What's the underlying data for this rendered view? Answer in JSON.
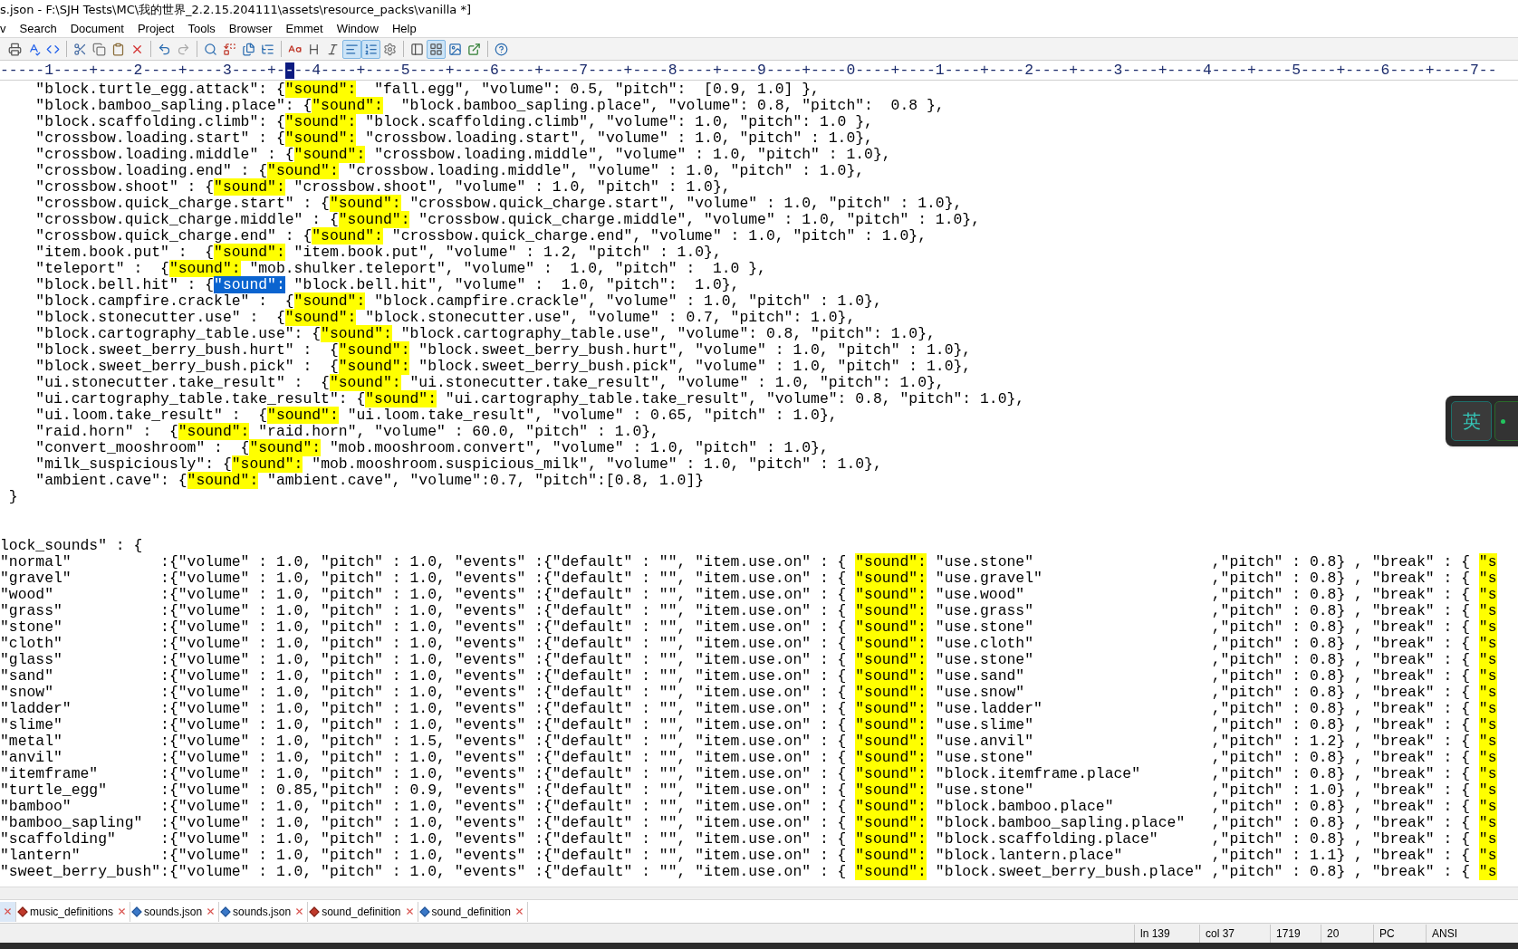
{
  "window": {
    "title": "s.json - F:\\SJH Tests\\MC\\我的世界_2.2.15.204111\\assets\\resource_packs\\vanilla *]"
  },
  "menu": [
    {
      "label": "v"
    },
    {
      "label": "Search"
    },
    {
      "label": "Document"
    },
    {
      "label": "Project"
    },
    {
      "label": "Tools"
    },
    {
      "label": "Browser"
    },
    {
      "label": "Emmet"
    },
    {
      "label": "Window"
    },
    {
      "label": "Help"
    }
  ],
  "toolbar": {
    "groups": [
      [
        {
          "on": false
        },
        {
          "on": false
        },
        {
          "on": false
        }
      ],
      [
        {
          "on": false
        },
        {
          "on": false
        },
        {
          "on": false
        },
        {
          "on": false
        }
      ],
      [
        {
          "on": false
        },
        {
          "on": false
        }
      ],
      [
        {
          "on": false
        },
        {
          "on": false
        },
        {
          "on": false
        },
        {
          "on": false
        }
      ],
      [
        {
          "on": false
        },
        {
          "on": false
        },
        {
          "on": false
        },
        {
          "on": true
        },
        {
          "on": true
        },
        {
          "on": false
        }
      ],
      [
        {
          "on": false
        },
        {
          "on": true
        },
        {
          "on": false
        },
        {
          "on": false
        }
      ],
      [
        {
          "on": false
        }
      ]
    ]
  },
  "ruler": {
    "left": "-----1----+----2----+----3----+-",
    "cursor": "-",
    "right": "--4----+----5----+----6----+----7----+----8----+----9----+----0----+----1----+----2----+----3----+----4----+----5----+----6----+----7--"
  },
  "editor": {
    "lines": [
      {
        "kind": "code",
        "segments": [
          {
            "kind": "text",
            "text": "    \"block.turtle_egg.attack\": {"
          },
          {
            "kind": "match",
            "text": "\"sound\":"
          },
          {
            "kind": "text",
            "text": "  \"fall.egg\", \"volume\": 0.5, \"pitch\":  [0.9, 1.0] },"
          }
        ]
      },
      {
        "kind": "code",
        "segments": [
          {
            "kind": "text",
            "text": "    \"block.bamboo_sapling.place\": {"
          },
          {
            "kind": "match",
            "text": "\"sound\":"
          },
          {
            "kind": "text",
            "text": "  \"block.bamboo_sapling.place\", \"volume\": 0.8, \"pitch\":  0.8 },"
          }
        ]
      },
      {
        "kind": "code",
        "segments": [
          {
            "kind": "text",
            "text": "    \"block.scaffolding.climb\": {"
          },
          {
            "kind": "match",
            "text": "\"sound\":"
          },
          {
            "kind": "text",
            "text": " \"block.scaffolding.climb\", \"volume\": 1.0, \"pitch\": 1.0 },"
          }
        ]
      },
      {
        "kind": "code",
        "segments": [
          {
            "kind": "text",
            "text": "    \"crossbow.loading.start\" : {"
          },
          {
            "kind": "match",
            "text": "\"sound\":"
          },
          {
            "kind": "text",
            "text": " \"crossbow.loading.start\", \"volume\" : 1.0, \"pitch\" : 1.0},"
          }
        ]
      },
      {
        "kind": "code",
        "segments": [
          {
            "kind": "text",
            "text": "    \"crossbow.loading.middle\" : {"
          },
          {
            "kind": "match",
            "text": "\"sound\":"
          },
          {
            "kind": "text",
            "text": " \"crossbow.loading.middle\", \"volume\" : 1.0, \"pitch\" : 1.0},"
          }
        ]
      },
      {
        "kind": "code",
        "segments": [
          {
            "kind": "text",
            "text": "    \"crossbow.loading.end\" : {"
          },
          {
            "kind": "match",
            "text": "\"sound\":"
          },
          {
            "kind": "text",
            "text": " \"crossbow.loading.middle\", \"volume\" : 1.0, \"pitch\" : 1.0},"
          }
        ]
      },
      {
        "kind": "code",
        "segments": [
          {
            "kind": "text",
            "text": "    \"crossbow.shoot\" : {"
          },
          {
            "kind": "match",
            "text": "\"sound\":"
          },
          {
            "kind": "text",
            "text": " \"crossbow.shoot\", \"volume\" : 1.0, \"pitch\" : 1.0},"
          }
        ]
      },
      {
        "kind": "code",
        "segments": [
          {
            "kind": "text",
            "text": "    \"crossbow.quick_charge.start\" : {"
          },
          {
            "kind": "match",
            "text": "\"sound\":"
          },
          {
            "kind": "text",
            "text": " \"crossbow.quick_charge.start\", \"volume\" : 1.0, \"pitch\" : 1.0},"
          }
        ]
      },
      {
        "kind": "code",
        "segments": [
          {
            "kind": "text",
            "text": "    \"crossbow.quick_charge.middle\" : {"
          },
          {
            "kind": "match",
            "text": "\"sound\":"
          },
          {
            "kind": "text",
            "text": " \"crossbow.quick_charge.middle\", \"volume\" : 1.0, \"pitch\" : 1.0},"
          }
        ]
      },
      {
        "kind": "code",
        "segments": [
          {
            "kind": "text",
            "text": "    \"crossbow.quick_charge.end\" : {"
          },
          {
            "kind": "match",
            "text": "\"sound\":"
          },
          {
            "kind": "text",
            "text": " \"crossbow.quick_charge.end\", \"volume\" : 1.0, \"pitch\" : 1.0},"
          }
        ]
      },
      {
        "kind": "code",
        "segments": [
          {
            "kind": "text",
            "text": "    \"item.book.put\" :  {"
          },
          {
            "kind": "match",
            "text": "\"sound\":"
          },
          {
            "kind": "text",
            "text": " \"item.book.put\", \"volume\" : 1.2, \"pitch\" : 1.0},"
          }
        ]
      },
      {
        "kind": "code",
        "segments": [
          {
            "kind": "text",
            "text": "    \"teleport\" :  {"
          },
          {
            "kind": "match",
            "text": "\"sound\":"
          },
          {
            "kind": "text",
            "text": " \"mob.shulker.teleport\", \"volume\" :  1.0, \"pitch\" :  1.0 },"
          }
        ]
      },
      {
        "kind": "code",
        "segments": [
          {
            "kind": "text",
            "text": "    \"block.bell.hit\" : {"
          },
          {
            "kind": "selected",
            "text": "\"sound\":"
          },
          {
            "kind": "text",
            "text": " \"block.bell.hit\", \"volume\" :  1.0, \"pitch\":  1.0},"
          }
        ]
      },
      {
        "kind": "code",
        "segments": [
          {
            "kind": "text",
            "text": "    \"block.campfire.crackle\" :  {"
          },
          {
            "kind": "match",
            "text": "\"sound\":"
          },
          {
            "kind": "text",
            "text": " \"block.campfire.crackle\", \"volume\" : 1.0, \"pitch\" : 1.0},"
          }
        ]
      },
      {
        "kind": "code",
        "segments": [
          {
            "kind": "text",
            "text": "    \"block.stonecutter.use\" :  {"
          },
          {
            "kind": "match",
            "text": "\"sound\":"
          },
          {
            "kind": "text",
            "text": " \"block.stonecutter.use\", \"volume\" : 0.7, \"pitch\": 1.0},"
          }
        ]
      },
      {
        "kind": "code",
        "segments": [
          {
            "kind": "text",
            "text": "    \"block.cartography_table.use\": {"
          },
          {
            "kind": "match",
            "text": "\"sound\":"
          },
          {
            "kind": "text",
            "text": " \"block.cartography_table.use\", \"volume\": 0.8, \"pitch\": 1.0},"
          }
        ]
      },
      {
        "kind": "code",
        "segments": [
          {
            "kind": "text",
            "text": "    \"block.sweet_berry_bush.hurt\" :  {"
          },
          {
            "kind": "match",
            "text": "\"sound\":"
          },
          {
            "kind": "text",
            "text": " \"block.sweet_berry_bush.hurt\", \"volume\" : 1.0, \"pitch\" : 1.0},"
          }
        ]
      },
      {
        "kind": "code",
        "segments": [
          {
            "kind": "text",
            "text": "    \"block.sweet_berry_bush.pick\" :  {"
          },
          {
            "kind": "match",
            "text": "\"sound\":"
          },
          {
            "kind": "text",
            "text": " \"block.sweet_berry_bush.pick\", \"volume\" : 1.0, \"pitch\" : 1.0},"
          }
        ]
      },
      {
        "kind": "code",
        "segments": [
          {
            "kind": "text",
            "text": "    \"ui.stonecutter.take_result\" :  {"
          },
          {
            "kind": "match",
            "text": "\"sound\":"
          },
          {
            "kind": "text",
            "text": " \"ui.stonecutter.take_result\", \"volume\" : 1.0, \"pitch\": 1.0},"
          }
        ]
      },
      {
        "kind": "code",
        "segments": [
          {
            "kind": "text",
            "text": "    \"ui.cartography_table.take_result\": {"
          },
          {
            "kind": "match",
            "text": "\"sound\":"
          },
          {
            "kind": "text",
            "text": " \"ui.cartography_table.take_result\", \"volume\": 0.8, \"pitch\": 1.0},"
          }
        ]
      },
      {
        "kind": "code",
        "segments": [
          {
            "kind": "text",
            "text": "    \"ui.loom.take_result\" :  {"
          },
          {
            "kind": "match",
            "text": "\"sound\":"
          },
          {
            "kind": "text",
            "text": " \"ui.loom.take_result\", \"volume\" : 0.65, \"pitch\" : 1.0},"
          }
        ]
      },
      {
        "kind": "code",
        "segments": [
          {
            "kind": "text",
            "text": "    \"raid.horn\" :  {"
          },
          {
            "kind": "match",
            "text": "\"sound\":"
          },
          {
            "kind": "text",
            "text": " \"raid.horn\", \"volume\" : 60.0, \"pitch\" : 1.0},"
          }
        ]
      },
      {
        "kind": "code",
        "segments": [
          {
            "kind": "text",
            "text": "    \"convert_mooshroom\" :  {"
          },
          {
            "kind": "match",
            "text": "\"sound\":"
          },
          {
            "kind": "text",
            "text": " \"mob.mooshroom.convert\", \"volume\" : 1.0, \"pitch\" : 1.0},"
          }
        ]
      },
      {
        "kind": "code",
        "segments": [
          {
            "kind": "text",
            "text": "    \"milk_suspiciously\": {"
          },
          {
            "kind": "match",
            "text": "\"sound\":"
          },
          {
            "kind": "text",
            "text": " \"mob.mooshroom.suspicious_milk\", \"volume\" : 1.0, \"pitch\" : 1.0},"
          }
        ]
      },
      {
        "kind": "code",
        "segments": [
          {
            "kind": "text",
            "text": "    \"ambient.cave\": {"
          },
          {
            "kind": "match",
            "text": "\"sound\":"
          },
          {
            "kind": "text",
            "text": " \"ambient.cave\", \"volume\":0.7, \"pitch\":[0.8, 1.0]}"
          }
        ]
      },
      {
        "kind": "code",
        "segments": [
          {
            "kind": "text",
            "text": " }"
          }
        ]
      },
      {
        "kind": "blank"
      },
      {
        "kind": "blank"
      },
      {
        "kind": "code",
        "segments": [
          {
            "kind": "text",
            "text": "lock_sounds\" : {"
          }
        ]
      },
      {
        "kind": "code",
        "segments": [
          {
            "kind": "text",
            "text": "\"normal\"          :{\"volume\" : 1.0, \"pitch\" : 1.0, \"events\" :{\"default\" : \"\", \"item.use.on\" : { "
          },
          {
            "kind": "match",
            "text": "\"sound\":"
          },
          {
            "kind": "text",
            "text": " \"use.stone\"                    ,\"pitch\" : 0.8} , \"break\" : { "
          },
          {
            "kind": "match",
            "text": "\"s"
          }
        ]
      },
      {
        "kind": "code",
        "segments": [
          {
            "kind": "text",
            "text": "\"gravel\"          :{\"volume\" : 1.0, \"pitch\" : 1.0, \"events\" :{\"default\" : \"\", \"item.use.on\" : { "
          },
          {
            "kind": "match",
            "text": "\"sound\":"
          },
          {
            "kind": "text",
            "text": " \"use.gravel\"                   ,\"pitch\" : 0.8} , \"break\" : { "
          },
          {
            "kind": "match",
            "text": "\"s"
          }
        ]
      },
      {
        "kind": "code",
        "segments": [
          {
            "kind": "text",
            "text": "\"wood\"            :{\"volume\" : 1.0, \"pitch\" : 1.0, \"events\" :{\"default\" : \"\", \"item.use.on\" : { "
          },
          {
            "kind": "match",
            "text": "\"sound\":"
          },
          {
            "kind": "text",
            "text": " \"use.wood\"                     ,\"pitch\" : 0.8} , \"break\" : { "
          },
          {
            "kind": "match",
            "text": "\"s"
          }
        ]
      },
      {
        "kind": "code",
        "segments": [
          {
            "kind": "text",
            "text": "\"grass\"           :{\"volume\" : 1.0, \"pitch\" : 1.0, \"events\" :{\"default\" : \"\", \"item.use.on\" : { "
          },
          {
            "kind": "match",
            "text": "\"sound\":"
          },
          {
            "kind": "text",
            "text": " \"use.grass\"                    ,\"pitch\" : 0.8} , \"break\" : { "
          },
          {
            "kind": "match",
            "text": "\"s"
          }
        ]
      },
      {
        "kind": "code",
        "segments": [
          {
            "kind": "text",
            "text": "\"stone\"           :{\"volume\" : 1.0, \"pitch\" : 1.0, \"events\" :{\"default\" : \"\", \"item.use.on\" : { "
          },
          {
            "kind": "match",
            "text": "\"sound\":"
          },
          {
            "kind": "text",
            "text": " \"use.stone\"                    ,\"pitch\" : 0.8} , \"break\" : { "
          },
          {
            "kind": "match",
            "text": "\"s"
          }
        ]
      },
      {
        "kind": "code",
        "segments": [
          {
            "kind": "text",
            "text": "\"cloth\"           :{\"volume\" : 1.0, \"pitch\" : 1.0, \"events\" :{\"default\" : \"\", \"item.use.on\" : { "
          },
          {
            "kind": "match",
            "text": "\"sound\":"
          },
          {
            "kind": "text",
            "text": " \"use.cloth\"                    ,\"pitch\" : 0.8} , \"break\" : { "
          },
          {
            "kind": "match",
            "text": "\"s"
          }
        ]
      },
      {
        "kind": "code",
        "segments": [
          {
            "kind": "text",
            "text": "\"glass\"           :{\"volume\" : 1.0, \"pitch\" : 1.0, \"events\" :{\"default\" : \"\", \"item.use.on\" : { "
          },
          {
            "kind": "match",
            "text": "\"sound\":"
          },
          {
            "kind": "text",
            "text": " \"use.stone\"                    ,\"pitch\" : 0.8} , \"break\" : { "
          },
          {
            "kind": "match",
            "text": "\"s"
          }
        ]
      },
      {
        "kind": "code",
        "segments": [
          {
            "kind": "text",
            "text": "\"sand\"            :{\"volume\" : 1.0, \"pitch\" : 1.0, \"events\" :{\"default\" : \"\", \"item.use.on\" : { "
          },
          {
            "kind": "match",
            "text": "\"sound\":"
          },
          {
            "kind": "text",
            "text": " \"use.sand\"                     ,\"pitch\" : 0.8} , \"break\" : { "
          },
          {
            "kind": "match",
            "text": "\"s"
          }
        ]
      },
      {
        "kind": "code",
        "segments": [
          {
            "kind": "text",
            "text": "\"snow\"            :{\"volume\" : 1.0, \"pitch\" : 1.0, \"events\" :{\"default\" : \"\", \"item.use.on\" : { "
          },
          {
            "kind": "match",
            "text": "\"sound\":"
          },
          {
            "kind": "text",
            "text": " \"use.snow\"                     ,\"pitch\" : 0.8} , \"break\" : { "
          },
          {
            "kind": "match",
            "text": "\"s"
          }
        ]
      },
      {
        "kind": "code",
        "segments": [
          {
            "kind": "text",
            "text": "\"ladder\"          :{\"volume\" : 1.0, \"pitch\" : 1.0, \"events\" :{\"default\" : \"\", \"item.use.on\" : { "
          },
          {
            "kind": "match",
            "text": "\"sound\":"
          },
          {
            "kind": "text",
            "text": " \"use.ladder\"                   ,\"pitch\" : 0.8} , \"break\" : { "
          },
          {
            "kind": "match",
            "text": "\"s"
          }
        ]
      },
      {
        "kind": "code",
        "segments": [
          {
            "kind": "text",
            "text": "\"slime\"           :{\"volume\" : 1.0, \"pitch\" : 1.0, \"events\" :{\"default\" : \"\", \"item.use.on\" : { "
          },
          {
            "kind": "match",
            "text": "\"sound\":"
          },
          {
            "kind": "text",
            "text": " \"use.slime\"                    ,\"pitch\" : 0.8} , \"break\" : { "
          },
          {
            "kind": "match",
            "text": "\"s"
          }
        ]
      },
      {
        "kind": "code",
        "segments": [
          {
            "kind": "text",
            "text": "\"metal\"           :{\"volume\" : 1.0, \"pitch\" : 1.5, \"events\" :{\"default\" : \"\", \"item.use.on\" : { "
          },
          {
            "kind": "match",
            "text": "\"sound\":"
          },
          {
            "kind": "text",
            "text": " \"use.anvil\"                    ,\"pitch\" : 1.2} , \"break\" : { "
          },
          {
            "kind": "match",
            "text": "\"s"
          }
        ]
      },
      {
        "kind": "code",
        "segments": [
          {
            "kind": "text",
            "text": "\"anvil\"           :{\"volume\" : 1.0, \"pitch\" : 1.0, \"events\" :{\"default\" : \"\", \"item.use.on\" : { "
          },
          {
            "kind": "match",
            "text": "\"sound\":"
          },
          {
            "kind": "text",
            "text": " \"use.stone\"                    ,\"pitch\" : 0.8} , \"break\" : { "
          },
          {
            "kind": "match",
            "text": "\"s"
          }
        ]
      },
      {
        "kind": "code",
        "segments": [
          {
            "kind": "text",
            "text": "\"itemframe\"       :{\"volume\" : 1.0, \"pitch\" : 1.0, \"events\" :{\"default\" : \"\", \"item.use.on\" : { "
          },
          {
            "kind": "match",
            "text": "\"sound\":"
          },
          {
            "kind": "text",
            "text": " \"block.itemframe.place\"        ,\"pitch\" : 0.8} , \"break\" : { "
          },
          {
            "kind": "match",
            "text": "\"s"
          }
        ]
      },
      {
        "kind": "code",
        "segments": [
          {
            "kind": "text",
            "text": "\"turtle_egg\"      :{\"volume\" : 0.85,\"pitch\" : 0.9, \"events\" :{\"default\" : \"\", \"item.use.on\" : { "
          },
          {
            "kind": "match",
            "text": "\"sound\":"
          },
          {
            "kind": "text",
            "text": " \"use.stone\"                    ,\"pitch\" : 1.0} , \"break\" : { "
          },
          {
            "kind": "match",
            "text": "\"s"
          }
        ]
      },
      {
        "kind": "code",
        "segments": [
          {
            "kind": "text",
            "text": "\"bamboo\"          :{\"volume\" : 1.0, \"pitch\" : 1.0, \"events\" :{\"default\" : \"\", \"item.use.on\" : { "
          },
          {
            "kind": "match",
            "text": "\"sound\":"
          },
          {
            "kind": "text",
            "text": " \"block.bamboo.place\"           ,\"pitch\" : 0.8} , \"break\" : { "
          },
          {
            "kind": "match",
            "text": "\"s"
          }
        ]
      },
      {
        "kind": "code",
        "segments": [
          {
            "kind": "text",
            "text": "\"bamboo_sapling\"  :{\"volume\" : 1.0, \"pitch\" : 1.0, \"events\" :{\"default\" : \"\", \"item.use.on\" : { "
          },
          {
            "kind": "match",
            "text": "\"sound\":"
          },
          {
            "kind": "text",
            "text": " \"block.bamboo_sapling.place\"   ,\"pitch\" : 0.8} , \"break\" : { "
          },
          {
            "kind": "match",
            "text": "\"s"
          }
        ]
      },
      {
        "kind": "code",
        "segments": [
          {
            "kind": "text",
            "text": "\"scaffolding\"     :{\"volume\" : 1.0, \"pitch\" : 1.0, \"events\" :{\"default\" : \"\", \"item.use.on\" : { "
          },
          {
            "kind": "match",
            "text": "\"sound\":"
          },
          {
            "kind": "text",
            "text": " \"block.scaffolding.place\"      ,\"pitch\" : 0.8} , \"break\" : { "
          },
          {
            "kind": "match",
            "text": "\"s"
          }
        ]
      },
      {
        "kind": "code",
        "segments": [
          {
            "kind": "text",
            "text": "\"lantern\"         :{\"volume\" : 1.0, \"pitch\" : 1.0, \"events\" :{\"default\" : \"\", \"item.use.on\" : { "
          },
          {
            "kind": "match",
            "text": "\"sound\":"
          },
          {
            "kind": "text",
            "text": " \"block.lantern.place\"          ,\"pitch\" : 1.1} , \"break\" : { "
          },
          {
            "kind": "match",
            "text": "\"s"
          }
        ]
      },
      {
        "kind": "code",
        "segments": [
          {
            "kind": "text",
            "text": "\"sweet_berry_bush\":{\"volume\" : 1.0, \"pitch\" : 1.0, \"events\" :{\"default\" : \"\", \"item.use.on\" : { "
          },
          {
            "kind": "match",
            "text": "\"sound\":"
          },
          {
            "kind": "text",
            "text": " \"block.sweet_berry_bush.place\" ,\"pitch\" : 0.8} , \"break\" : { "
          },
          {
            "kind": "match",
            "text": "\"s"
          }
        ]
      }
    ]
  },
  "ime": {
    "label": "英"
  },
  "tabs": [
    {
      "selected": true
    },
    {
      "label": "music_definitions",
      "selected": false,
      "modified": true
    },
    {
      "label": "sounds.json",
      "selected": false,
      "modified": false
    },
    {
      "label": "sounds.json",
      "selected": false,
      "modified": false
    },
    {
      "label": "sound_definition",
      "selected": false,
      "modified": true
    },
    {
      "label": "sound_definition",
      "selected": false,
      "modified": false
    }
  ],
  "status_bar": [
    "ln 139",
    "col 37",
    "1719",
    "20",
    "PC",
    "ANSI"
  ]
}
